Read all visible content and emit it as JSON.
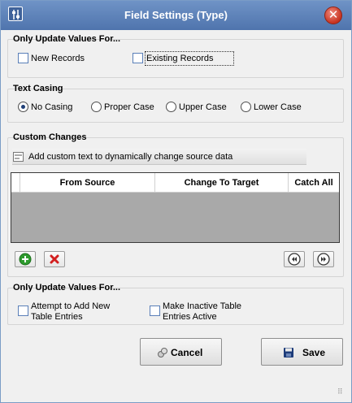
{
  "window": {
    "title": "Field Settings (Type)",
    "icon": "settings-sliders-icon",
    "close_icon": "close-icon"
  },
  "update_group_1": {
    "title": "Only Update Values For...",
    "new_records": {
      "label": "New Records",
      "checked": false
    },
    "existing_records": {
      "label": "Existing Records",
      "checked": false
    }
  },
  "text_casing": {
    "title": "Text Casing",
    "options": [
      {
        "label": "No Casing",
        "selected": true
      },
      {
        "label": "Proper Case",
        "selected": false
      },
      {
        "label": "Upper Case",
        "selected": false
      },
      {
        "label": "Lower Case",
        "selected": false
      }
    ]
  },
  "custom_changes": {
    "title": "Custom Changes",
    "add_text_button": "Add custom text to dynamically change source data",
    "grid": {
      "columns": [
        "From Source",
        "Change To Target",
        "Catch All"
      ],
      "rows": []
    },
    "add_icon": "plus-icon",
    "delete_icon": "delete-x-icon",
    "prev_icon": "previous-icon",
    "next_icon": "next-icon"
  },
  "update_group_2": {
    "title": "Only Update Values For...",
    "add_new": {
      "label_line1": "Attempt to Add New",
      "label_line2": "Table Entries",
      "checked": false
    },
    "make_active": {
      "label_line1": "Make Inactive Table",
      "label_line2": "Entries Active",
      "checked": false
    }
  },
  "footer": {
    "cancel_label": "Cancel",
    "save_label": "Save",
    "cancel_icon": "cancel-icon",
    "save_icon": "save-disk-icon"
  },
  "colors": {
    "titlebar": "#5a7fb8",
    "grid_background": "#a9a9a9",
    "close": "#c7321f",
    "add_green": "#2e9b2e",
    "delete_red": "#d21f1f"
  }
}
